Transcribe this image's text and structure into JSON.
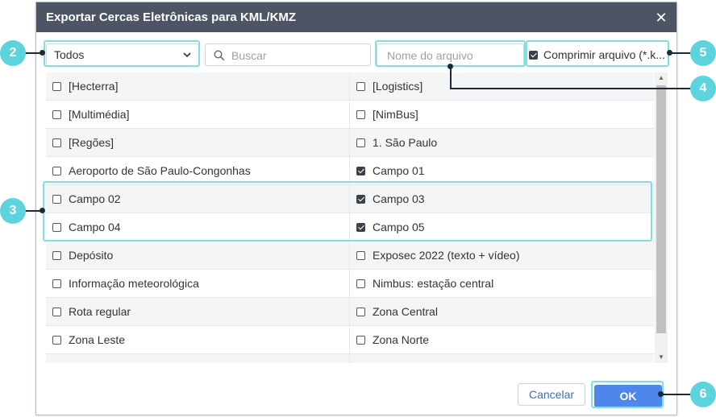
{
  "dialog": {
    "title": "Exportar Cercas Eletrônicas para KML/KMZ",
    "close_glyph": "✕"
  },
  "toolbar": {
    "filter_value": "Todos",
    "search_placeholder": "Buscar",
    "filename_placeholder": "Nome do arquivo",
    "compress_label": "Comprimir arquivo (*.k...",
    "compress_checked": true
  },
  "items": [
    {
      "left": "[Hecterra]",
      "left_checked": false,
      "right": "[Logistics]",
      "right_checked": false
    },
    {
      "left": "[Multimédia]",
      "left_checked": false,
      "right": "[NimBus]",
      "right_checked": false
    },
    {
      "left": "[Regões]",
      "left_checked": false,
      "right": "1. São Paulo",
      "right_checked": false
    },
    {
      "left": "Aeroporto de São Paulo-Congonhas",
      "left_checked": false,
      "right": "Campo 01",
      "right_checked": true
    },
    {
      "left": "Campo 02",
      "left_checked": false,
      "right": "Campo 03",
      "right_checked": true
    },
    {
      "left": "Campo 04",
      "left_checked": false,
      "right": "Campo 05",
      "right_checked": true
    },
    {
      "left": "Depósito",
      "left_checked": false,
      "right": "Exposec 2022 (texto + vídeo)",
      "right_checked": false
    },
    {
      "left": "Informação meteorológica",
      "left_checked": false,
      "right": "Nimbus: estação central",
      "right_checked": false
    },
    {
      "left": "Rota regular",
      "left_checked": false,
      "right": "Zona Central",
      "right_checked": false
    },
    {
      "left": "Zona Leste",
      "left_checked": false,
      "right": "Zona Norte",
      "right_checked": false
    },
    {
      "left": "",
      "left_checked": null,
      "right": "",
      "right_checked": null
    }
  ],
  "footer": {
    "cancel_label": "Cancelar",
    "ok_label": "OK"
  },
  "callouts": [
    "2",
    "3",
    "4",
    "5",
    "6"
  ],
  "colors": {
    "titlebar": "#4d5565",
    "accent": "#4f86ec",
    "highlight": "#7fdfe7",
    "badge": "#5cd3dd"
  }
}
